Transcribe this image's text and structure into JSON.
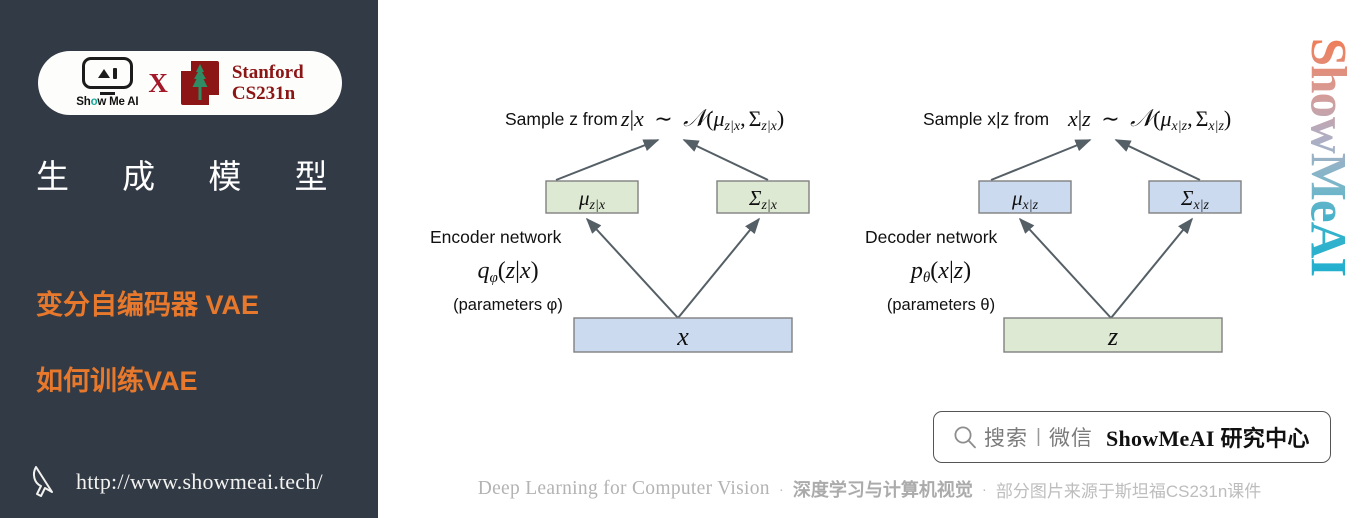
{
  "sidebar": {
    "badge": {
      "logo_word_pre": "Sh",
      "logo_word_o": "o",
      "logo_word_post": "w Me AI",
      "cross": "X",
      "stanford_line1": "Stanford",
      "stanford_line2": "CS231n"
    },
    "section_title": "生 成 模 型",
    "topics": [
      "变分自编码器 VAE",
      "如何训练VAE"
    ],
    "url": "http://www.showmeai.tech/"
  },
  "main": {
    "watermark": "ShowMeAI",
    "encoder": {
      "sample_label": "Sample z from",
      "sample_formula": "z|x ~ N(μ_z|x, Σ_z|x)",
      "mu_box": "μ_z|x",
      "sigma_box": "Σ_z|x",
      "network_label": "Encoder network",
      "network_formula": "q_φ(z|x)",
      "parameters": "(parameters φ)",
      "input_box": "x"
    },
    "decoder": {
      "sample_label": "Sample x|z from",
      "sample_formula": "x|z ~ N(μ_x|z, Σ_x|z)",
      "mu_box": "μ_x|z",
      "sigma_box": "Σ_x|z",
      "network_label": "Decoder network",
      "network_formula": "p_θ(x|z)",
      "parameters": "(parameters θ)",
      "input_box": "z"
    },
    "wechat": {
      "search_text": "搜索",
      "divider": "|",
      "channel_text": "微信",
      "account_name": "ShowMeAI 研究中心"
    },
    "footer": {
      "english": "Deep Learning for Computer Vision",
      "dot1": "·",
      "chinese_bold": "深度学习与计算机视觉",
      "dot2": "·",
      "chinese_note": "部分图片来源于斯坦福CS231n课件"
    }
  },
  "colors": {
    "sidebar_bg": "#323a45",
    "accent_orange": "#e8792c",
    "stanford_red": "#8c1515",
    "box_green": "#dde9d3",
    "box_blue": "#ccdaf0",
    "box_border": "#808080",
    "arrow": "#555f66"
  }
}
